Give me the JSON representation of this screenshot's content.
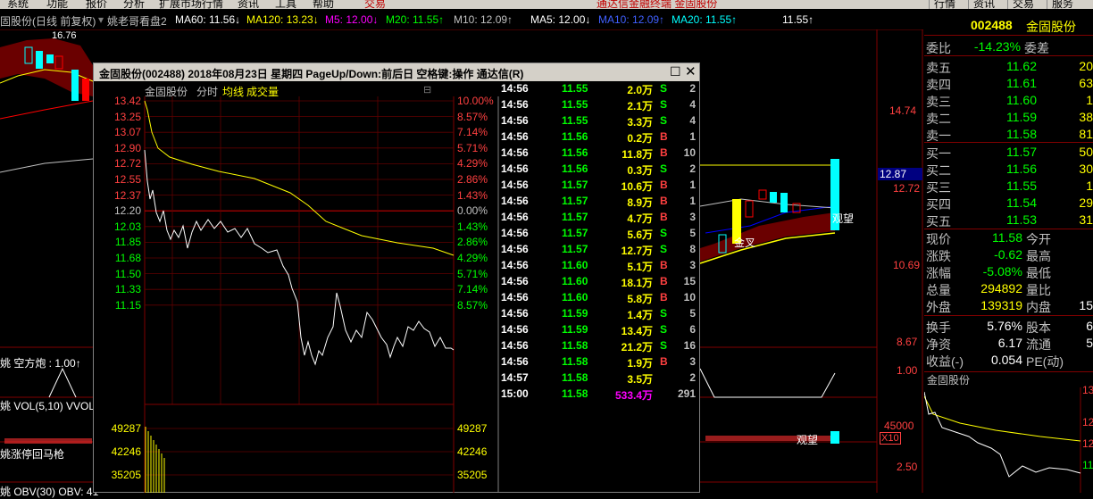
{
  "menu": {
    "items": [
      "系统",
      "功能",
      "报价",
      "分析",
      "扩展市场行情",
      "资讯",
      "工具",
      "帮助"
    ],
    "trade": "交易",
    "center": "通达信金融终端 金固股份",
    "right": [
      "行情",
      "资讯",
      "交易",
      "服务"
    ]
  },
  "legend": {
    "title": "固股份(日线 前复权)",
    "sub": "姚老哥看盘2",
    "ma60": "MA60: 11.56↓",
    "ma120": "MA120: 13.23↓",
    "m5": "M5: 12.00↓",
    "m20": "M20: 11.55↑",
    "m10": "M10: 12.09↑",
    "ma5": "MA5: 12.00↓",
    "ma10": "MA10: 12.09↑",
    "ma20": "MA20: 11.55↑",
    "last": "11.55↑"
  },
  "left": {
    "top_price": "16.76",
    "kongfangpao": "姚 空方炮 : 1.00↑",
    "vol": "姚 VOL(5,10) VVOL",
    "zhangting": "姚涨停回马枪",
    "obv": "姚 OBV(30) OBV: 41"
  },
  "kline_right": {
    "axis": [
      "14.74",
      "12.87",
      "12.72",
      "10.69",
      "8.67",
      "1.00",
      "45000",
      "X10",
      "2.50"
    ],
    "jincha": "金叉",
    "guanwang": "观望",
    "guanwang2": "观望"
  },
  "quote": {
    "code": "002488",
    "name": "金固股份",
    "weibi_label": "委比",
    "weibi": "-14.23%",
    "weicha_label": "委差",
    "sells": [
      {
        "label": "卖五",
        "price": "11.62",
        "vol": "20"
      },
      {
        "label": "卖四",
        "price": "11.61",
        "vol": "63"
      },
      {
        "label": "卖三",
        "price": "11.60",
        "vol": "1"
      },
      {
        "label": "卖二",
        "price": "11.59",
        "vol": "38"
      },
      {
        "label": "卖一",
        "price": "11.58",
        "vol": "81"
      }
    ],
    "buys": [
      {
        "label": "买一",
        "price": "11.57",
        "vol": "50"
      },
      {
        "label": "买二",
        "price": "11.56",
        "vol": "30"
      },
      {
        "label": "买三",
        "price": "11.55",
        "vol": "1"
      },
      {
        "label": "买四",
        "price": "11.54",
        "vol": "29"
      },
      {
        "label": "买五",
        "price": "11.53",
        "vol": "31"
      }
    ],
    "stats": [
      {
        "l": "现价",
        "v": "11.58",
        "l2": "今开",
        "v2": ""
      },
      {
        "l": "涨跌",
        "v": "-0.62",
        "l2": "最高",
        "v2": ""
      },
      {
        "l": "涨幅",
        "v": "-5.08%",
        "l2": "最低",
        "v2": ""
      },
      {
        "l": "总量",
        "v": "294892",
        "l2": "量比",
        "v2": ""
      },
      {
        "l": "外盘",
        "v": "139319",
        "l2": "内盘",
        "v2": "15"
      },
      {
        "l": "换手",
        "v": "5.76%",
        "l2": "股本",
        "v2": "6"
      },
      {
        "l": "净资",
        "v": "6.17",
        "l2": "流通",
        "v2": "5"
      },
      {
        "l": "收益(-)",
        "v": "0.054",
        "l2": "PE(动)",
        "v2": ""
      }
    ],
    "mini_title": "金固股份",
    "mini_axis": [
      "13",
      "12",
      "12",
      "11"
    ]
  },
  "popup": {
    "title": "金固股份(002488) 2018年08月23日 星期四 PageUp/Down:前后日 空格键:操作 通达信(R)",
    "name": "金固股份",
    "tab1": "分时",
    "tab2": "均线",
    "tab3": "成交量",
    "prices": [
      "13.42",
      "13.25",
      "13.07",
      "12.90",
      "12.72",
      "12.55",
      "12.37",
      "12.20",
      "12.03",
      "11.85",
      "11.68",
      "11.50",
      "11.33",
      "11.15"
    ],
    "pcts": [
      "10.00%",
      "8.57%",
      "7.14%",
      "5.71%",
      "4.29%",
      "2.86%",
      "1.43%",
      "0.00%",
      "1.43%",
      "2.86%",
      "4.29%",
      "5.71%",
      "7.14%",
      "8.57%"
    ],
    "vols": [
      "49287",
      "42246",
      "35205"
    ],
    "ticks": [
      {
        "t": "14:56",
        "p": "11.55",
        "v": "2.0万",
        "d": "S",
        "n": "2"
      },
      {
        "t": "14:56",
        "p": "11.55",
        "v": "2.1万",
        "d": "S",
        "n": "4"
      },
      {
        "t": "14:56",
        "p": "11.55",
        "v": "3.3万",
        "d": "S",
        "n": "4"
      },
      {
        "t": "14:56",
        "p": "11.56",
        "v": "0.2万",
        "d": "B",
        "n": "1"
      },
      {
        "t": "14:56",
        "p": "11.56",
        "v": "11.8万",
        "d": "B",
        "n": "10"
      },
      {
        "t": "14:56",
        "p": "11.56",
        "v": "0.3万",
        "d": "S",
        "n": "2"
      },
      {
        "t": "14:56",
        "p": "11.57",
        "v": "10.6万",
        "d": "B",
        "n": "1"
      },
      {
        "t": "14:56",
        "p": "11.57",
        "v": "8.9万",
        "d": "B",
        "n": "1"
      },
      {
        "t": "14:56",
        "p": "11.57",
        "v": "4.7万",
        "d": "B",
        "n": "3"
      },
      {
        "t": "14:56",
        "p": "11.57",
        "v": "5.6万",
        "d": "S",
        "n": "5"
      },
      {
        "t": "14:56",
        "p": "11.57",
        "v": "12.7万",
        "d": "S",
        "n": "8"
      },
      {
        "t": "14:56",
        "p": "11.60",
        "v": "5.1万",
        "d": "B",
        "n": "3"
      },
      {
        "t": "14:56",
        "p": "11.60",
        "v": "18.1万",
        "d": "B",
        "n": "15"
      },
      {
        "t": "14:56",
        "p": "11.60",
        "v": "5.8万",
        "d": "B",
        "n": "10"
      },
      {
        "t": "14:56",
        "p": "11.59",
        "v": "1.4万",
        "d": "S",
        "n": "5"
      },
      {
        "t": "14:56",
        "p": "11.59",
        "v": "13.4万",
        "d": "S",
        "n": "6"
      },
      {
        "t": "14:56",
        "p": "11.58",
        "v": "21.2万",
        "d": "S",
        "n": "16"
      },
      {
        "t": "14:56",
        "p": "11.58",
        "v": "1.9万",
        "d": "B",
        "n": "3"
      },
      {
        "t": "14:57",
        "p": "11.58",
        "v": "3.5万",
        "d": "",
        "n": "2"
      },
      {
        "t": "15:00",
        "p": "11.58",
        "v": "533.4万",
        "d": "",
        "n": "291"
      }
    ]
  }
}
